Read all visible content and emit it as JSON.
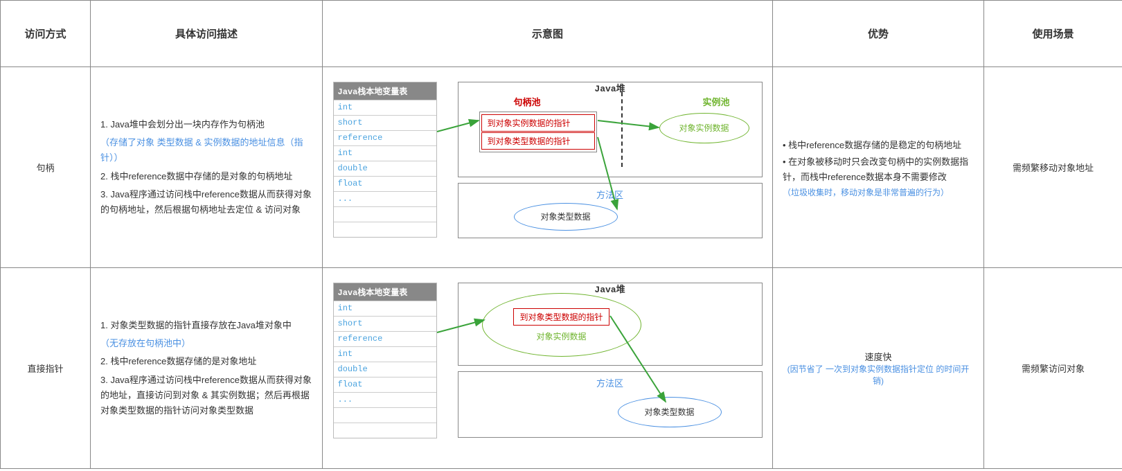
{
  "headers": {
    "col1": "访问方式",
    "col2": "具体访问描述",
    "col3": "示意图",
    "col4": "优势",
    "col5": "使用场景"
  },
  "stack": {
    "title": "Java栈本地变量表",
    "cells": [
      "int",
      "short",
      "reference",
      "int",
      "double",
      "float",
      "...",
      "",
      ""
    ]
  },
  "heap_title": "Java堆",
  "method_area_title": "方法区",
  "labels": {
    "handle_pool": "句柄池",
    "instance_pool": "实例池",
    "ptr_instance": "到对象实例数据的指针",
    "ptr_type": "到对象类型数据的指针",
    "instance_data": "对象实例数据",
    "type_data": "对象类型数据"
  },
  "rows": [
    {
      "name": "句柄",
      "desc": [
        {
          "text": "1. Java堆中会划分出一块内存作为句柄池"
        },
        {
          "text": "（存储了对象 类型数据 & 实例数据的地址信息（指针））",
          "blue": true
        },
        {
          "text": "2. 栈中reference数据中存储的是对象的句柄地址"
        },
        {
          "text": "3. Java程序通过访问栈中reference数据从而获得对象的句柄地址，然后根据句柄地址去定位 & 访问对象"
        }
      ],
      "advantages": {
        "bullets": [
          "栈中reference数据存储的是稳定的句柄地址",
          "在对象被移动时只会改变句柄中的实例数据指针，而栈中reference数据本身不需要修改"
        ],
        "note": "（垃圾收集时，移动对象是非常普遍的行为）"
      },
      "scene": "需频繁移动对象地址"
    },
    {
      "name": "直接指针",
      "desc": [
        {
          "text": "1. 对象类型数据的指针直接存放在Java堆对象中"
        },
        {
          "text": "（无存放在句柄池中）",
          "blue": true
        },
        {
          "text": "2. 栈中reference数据存储的是对象地址"
        },
        {
          "text": "3. Java程序通过访问栈中reference数据从而获得对象的地址，直接访问到对象 & 其实例数据；然后再根据对象类型数据的指针访问对象类型数据"
        }
      ],
      "advantages": {
        "centered": true,
        "main": "速度快",
        "note": "(因节省了 一次到对象实例数据指针定位 的时间开销)"
      },
      "scene": "需频繁访问对象"
    }
  ]
}
